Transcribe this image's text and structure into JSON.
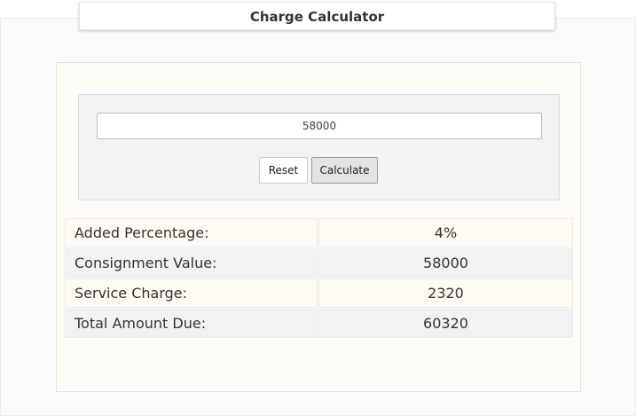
{
  "title": "Charge Calculator",
  "form": {
    "amount_value": "58000",
    "reset_label": "Reset",
    "calculate_label": "Calculate"
  },
  "results": [
    {
      "label": "Added Percentage:",
      "value": "4%"
    },
    {
      "label": "Consignment Value:",
      "value": "58000"
    },
    {
      "label": "Service Charge:",
      "value": "2320"
    },
    {
      "label": "Total Amount Due:",
      "value": "60320"
    }
  ]
}
